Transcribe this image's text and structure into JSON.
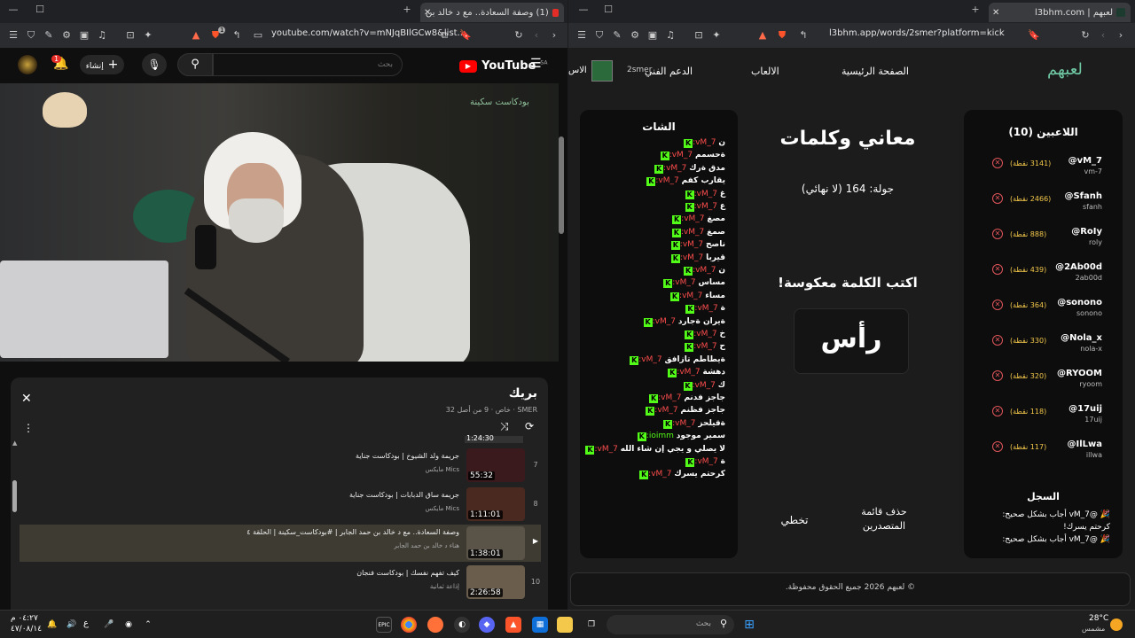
{
  "left_window": {
    "tab_title": "(1) وصفة السعادة.. مع د خالد بن",
    "url": "youtube.com/watch?v=mNJqBIlGCw8&list...",
    "badge": "1"
  },
  "right_window": {
    "tab_title": "لعبهم | l3bhm.com",
    "url": "l3bhm.app/words/2smer?platform=kick"
  },
  "youtube": {
    "logo_text": "YouTube",
    "logo_sup": "SA",
    "search_placeholder": "بحث",
    "create_label": "إنشاء",
    "notif_count": "1",
    "video_watermark": "بودكاست سكينة",
    "playlist": {
      "title": "بريك",
      "meta": "SMER · خاص · 9 من أصل 32",
      "top_duration": "1:24:30",
      "items": [
        {
          "index": "7",
          "title": "جريمة ولد الشيوخ | بودكاست جناية",
          "channel": "Mics مايكس",
          "duration": "55:32",
          "thumb_color": "#3a1a1d"
        },
        {
          "index": "8",
          "title": "جريمة ساق الدبابات | بودكاست جناية",
          "channel": "Mics مايكس",
          "duration": "1:11:01",
          "thumb_color": "#4a2a20"
        },
        {
          "index": "▶",
          "title": "وصفة السعادة.. مع د خالد بن حمد الجابر | #بودكاست_سكينة | الحلقة ٤",
          "channel": "هناء د خالد بن حمد الجابر",
          "duration": "1:38:01",
          "thumb_color": "#5a5348"
        },
        {
          "index": "10",
          "title": "كيف تفهم نفسك | بودكاست فنجان",
          "channel": "إذاعة ثمانية",
          "duration": "2:26:58",
          "thumb_color": "#6a5d4c"
        }
      ]
    }
  },
  "site": {
    "logo": "لعبهم",
    "nav": [
      "الصفحة الرئيسية",
      "الالعاب",
      "الدعم الفني"
    ],
    "user_label": "2smer",
    "nav_extra": "الاس",
    "players_title": "اللاعبين (10)",
    "players": [
      {
        "name": "@vM_7",
        "user": "vm-7",
        "points": "(3141 نقطة)"
      },
      {
        "name": "@Sfanh",
        "user": "sfanh",
        "points": "(2466 نقطة)"
      },
      {
        "name": "@RoIy",
        "user": "roly",
        "points": "(888 نقطة)"
      },
      {
        "name": "@2Ab00d",
        "user": "2ab00d",
        "points": "(439 نقطة)"
      },
      {
        "name": "@sonono",
        "user": "sonono",
        "points": "(364 نقطة)"
      },
      {
        "name": "@Nola_x",
        "user": "nola-x",
        "points": "(330 نقطة)"
      },
      {
        "name": "@RYOOM",
        "user": "ryoom",
        "points": "(320 نقطة)"
      },
      {
        "name": "@17uij",
        "user": "17uij",
        "points": "(118 نقطة)"
      },
      {
        "name": "@IlLwa",
        "user": "illwa",
        "points": "(117 نقطة)"
      }
    ],
    "log_title": "السجل",
    "log_lines": [
      "🎉 @vM_7 أجاب بشكل صحيح:",
      "كرحتم يسرك!",
      "🎉 @vM_7 أجاب بشكل صحيح:"
    ],
    "game_title": "معاني وكلمات",
    "round": "جولة: 164 (لا نهائي)",
    "prompt": "اكتب الكلمة معكوسة!",
    "word": "رأس",
    "btn_clear": "حذف قائمة المتصدرين",
    "btn_skip": "تخطي",
    "chat_title": "الشات",
    "chat": [
      {
        "user": "vM_7:",
        "msg": "ن"
      },
      {
        "user": "vM_7:",
        "msg": "ةحسمم"
      },
      {
        "user": "vM_7:",
        "msg": "مدق ةرك"
      },
      {
        "user": "vM_7:",
        "msg": "يقارب كفم"
      },
      {
        "user": "vM_7:",
        "msg": "غ"
      },
      {
        "user": "vM_7:",
        "msg": "ع"
      },
      {
        "user": "vM_7:",
        "msg": "مصغ"
      },
      {
        "user": "vM_7:",
        "msg": "صمغ"
      },
      {
        "user": "vM_7:",
        "msg": "ناصح"
      },
      {
        "user": "vM_7:",
        "msg": "قيربا"
      },
      {
        "user": "vM_7:",
        "msg": "ن"
      },
      {
        "user": "vM_7:",
        "msg": "مساس"
      },
      {
        "user": "vM_7:",
        "msg": "مساء"
      },
      {
        "user": "vM_7:",
        "msg": "ة"
      },
      {
        "user": "vM_7:",
        "msg": "ةيران ةجارد"
      },
      {
        "user": "vM_7:",
        "msg": "خ"
      },
      {
        "user": "vM_7:",
        "msg": "ح"
      },
      {
        "user": "vM_7:",
        "msg": "ةيطاطم تازافق"
      },
      {
        "user": "vM_7:",
        "msg": "دهشة"
      },
      {
        "user": "vM_7:",
        "msg": "ك"
      },
      {
        "user": "vM_7:",
        "msg": "جاجز فدنم"
      },
      {
        "user": "vM_7:",
        "msg": "جاجز فظنم"
      },
      {
        "user": "vM_7:",
        "msg": "ةقيلحز"
      },
      {
        "user": "ioimm:",
        "msg": "سمير موجود"
      },
      {
        "user": "vM_7:",
        "msg": "لا يصلي و يجي إن شاء الله"
      },
      {
        "user": "vM_7:",
        "msg": "ة"
      },
      {
        "user": "vM_7:",
        "msg": "كرحتم يسرك"
      }
    ],
    "footer": "© لعبهم 2026 جميع الحقوق محفوظة."
  },
  "taskbar": {
    "time": "٠٤:٢٧ م",
    "date": "٤٧/٠٨/١٤",
    "search_placeholder": "بحث",
    "weather_temp": "28°C",
    "weather_desc": "مشمس",
    "lang": "ع"
  }
}
